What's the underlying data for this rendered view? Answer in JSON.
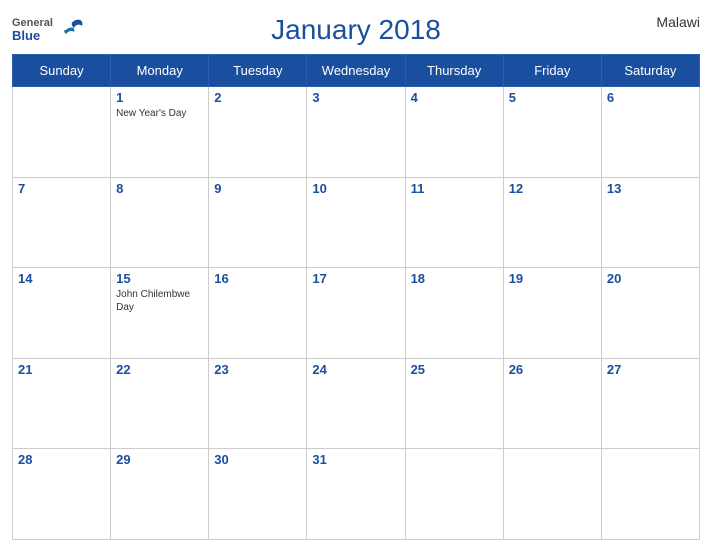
{
  "header": {
    "title": "January 2018",
    "country": "Malawi",
    "logo": {
      "general": "General",
      "blue": "Blue"
    }
  },
  "weekdays": [
    "Sunday",
    "Monday",
    "Tuesday",
    "Wednesday",
    "Thursday",
    "Friday",
    "Saturday"
  ],
  "weeks": [
    [
      {
        "day": "",
        "events": []
      },
      {
        "day": "1",
        "events": [
          "New Year's Day"
        ]
      },
      {
        "day": "2",
        "events": []
      },
      {
        "day": "3",
        "events": []
      },
      {
        "day": "4",
        "events": []
      },
      {
        "day": "5",
        "events": []
      },
      {
        "day": "6",
        "events": []
      }
    ],
    [
      {
        "day": "7",
        "events": []
      },
      {
        "day": "8",
        "events": []
      },
      {
        "day": "9",
        "events": []
      },
      {
        "day": "10",
        "events": []
      },
      {
        "day": "11",
        "events": []
      },
      {
        "day": "12",
        "events": []
      },
      {
        "day": "13",
        "events": []
      }
    ],
    [
      {
        "day": "14",
        "events": []
      },
      {
        "day": "15",
        "events": [
          "John Chilembwe Day"
        ]
      },
      {
        "day": "16",
        "events": []
      },
      {
        "day": "17",
        "events": []
      },
      {
        "day": "18",
        "events": []
      },
      {
        "day": "19",
        "events": []
      },
      {
        "day": "20",
        "events": []
      }
    ],
    [
      {
        "day": "21",
        "events": []
      },
      {
        "day": "22",
        "events": []
      },
      {
        "day": "23",
        "events": []
      },
      {
        "day": "24",
        "events": []
      },
      {
        "day": "25",
        "events": []
      },
      {
        "day": "26",
        "events": []
      },
      {
        "day": "27",
        "events": []
      }
    ],
    [
      {
        "day": "28",
        "events": []
      },
      {
        "day": "29",
        "events": []
      },
      {
        "day": "30",
        "events": []
      },
      {
        "day": "31",
        "events": []
      },
      {
        "day": "",
        "events": []
      },
      {
        "day": "",
        "events": []
      },
      {
        "day": "",
        "events": []
      }
    ]
  ]
}
